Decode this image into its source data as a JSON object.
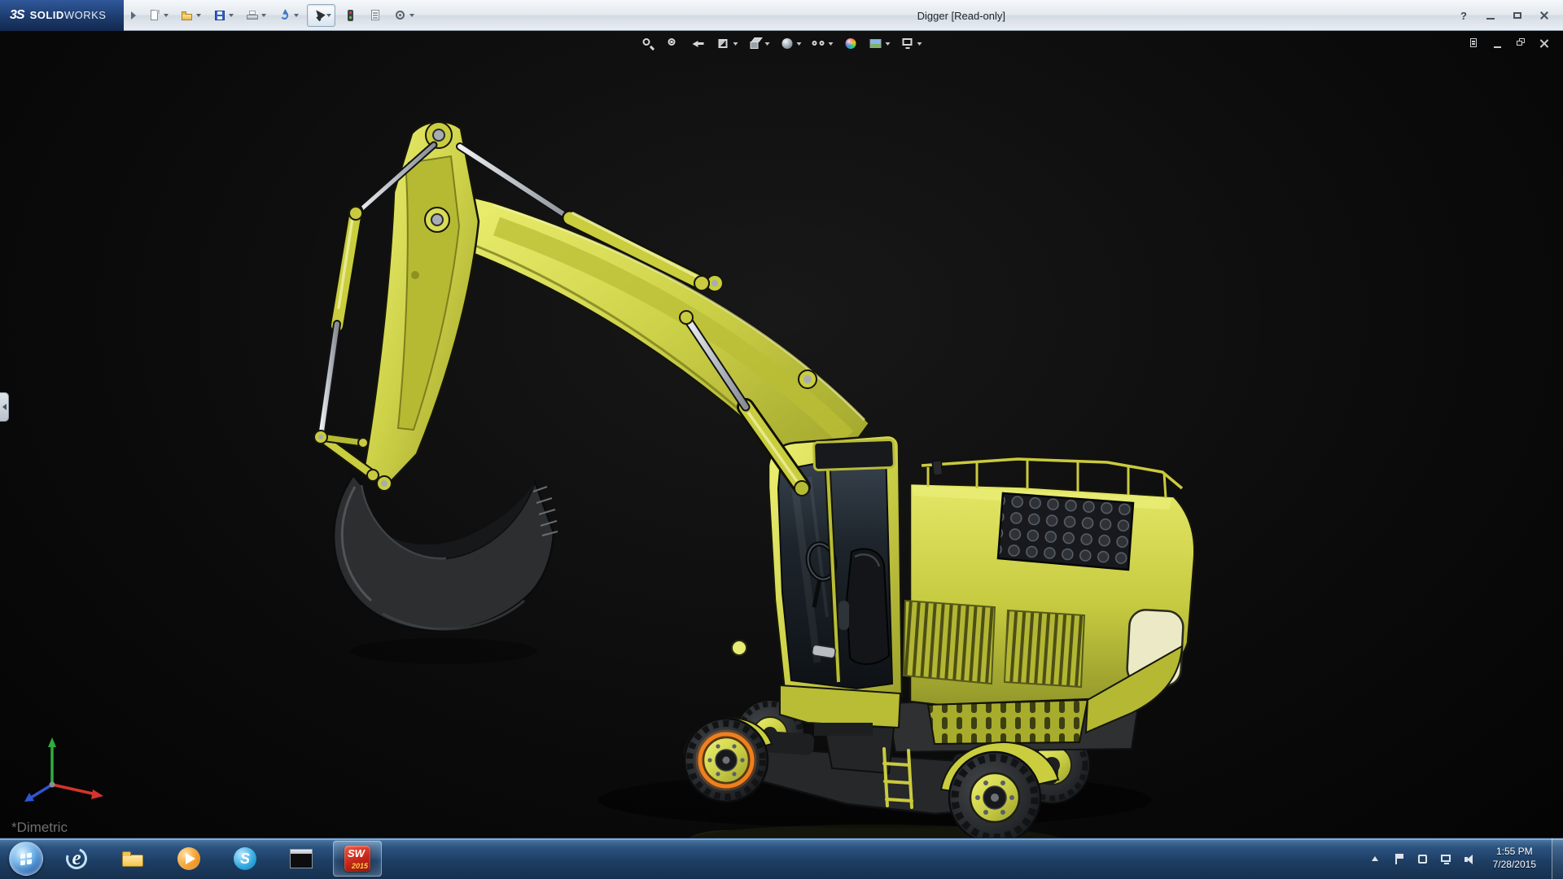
{
  "window": {
    "brand": {
      "mark": "3S",
      "name_bold": "SOLID",
      "name_light": "WORKS"
    },
    "title": "Digger [Read-only]",
    "controls": [
      {
        "name": "help-button",
        "icon": "win-help",
        "glyph": "?"
      },
      {
        "name": "minimize-button",
        "icon": "win-min"
      },
      {
        "name": "maximize-button",
        "icon": "win-max"
      },
      {
        "name": "close-button",
        "icon": "win-close"
      }
    ]
  },
  "main_toolbar": {
    "items": [
      {
        "name": "new-document-button",
        "icon": "new",
        "dropdown": true
      },
      {
        "name": "open-button",
        "icon": "open",
        "dropdown": true
      },
      {
        "name": "save-button",
        "icon": "save",
        "dropdown": true
      },
      {
        "name": "print-button",
        "icon": "print",
        "dropdown": true
      },
      {
        "name": "undo-button",
        "icon": "undo",
        "dropdown": true
      },
      {
        "name": "select-button",
        "icon": "select",
        "dropdown": true,
        "pressed": true
      },
      {
        "name": "rebuild-button",
        "icon": "rebuild"
      },
      {
        "name": "file-properties-button",
        "icon": "file-properties"
      },
      {
        "name": "options-button",
        "icon": "options",
        "dropdown": true
      }
    ]
  },
  "viewport": {
    "heads_up_toolbar": [
      {
        "name": "zoom-to-fit-button",
        "icon": "zoom-fit"
      },
      {
        "name": "zoom-to-area-button",
        "icon": "zoom-area"
      },
      {
        "name": "previous-view-button",
        "icon": "prev-view"
      },
      {
        "name": "section-view-button",
        "icon": "section",
        "dropdown": true
      },
      {
        "name": "view-orientation-button",
        "icon": "orientation",
        "dropdown": true
      },
      {
        "name": "display-style-button",
        "icon": "display-style",
        "dropdown": true
      },
      {
        "name": "hide-show-items-button",
        "icon": "hide-show",
        "dropdown": true
      },
      {
        "name": "edit-appearance-button",
        "icon": "appearance"
      },
      {
        "name": "apply-scene-button",
        "icon": "scene",
        "dropdown": true
      },
      {
        "name": "view-settings-button",
        "icon": "view-settings",
        "dropdown": true
      }
    ],
    "doc_controls": [
      {
        "name": "document-icon",
        "icon": "doc-part"
      },
      {
        "name": "doc-minimize-button",
        "icon": "doc-min"
      },
      {
        "name": "doc-restore-button",
        "icon": "doc-restore"
      },
      {
        "name": "doc-close-button",
        "icon": "doc-close"
      }
    ],
    "view_label": "*Dimetric",
    "model": {
      "name": "Digger",
      "body_color": "#c9cd3e",
      "selection_highlight_color": "#f07f1c"
    }
  },
  "taskbar": {
    "items": [
      {
        "name": "internet-explorer-button",
        "icon": "ie",
        "glyph": "e"
      },
      {
        "name": "windows-explorer-button",
        "icon": "explorer"
      },
      {
        "name": "media-player-button",
        "icon": "wmp"
      },
      {
        "name": "skype-button",
        "icon": "skype",
        "glyph": "S"
      },
      {
        "name": "command-prompt-button",
        "icon": "cmd"
      },
      {
        "name": "solidworks-2015-button",
        "icon": "sw2015",
        "glyph": "SW",
        "badge": "2015",
        "running": true
      }
    ],
    "tray": {
      "icons": [
        {
          "name": "show-hidden-icons-button",
          "icon": "tray-chevron"
        },
        {
          "name": "action-center-flag-button",
          "icon": "tray-flag"
        },
        {
          "name": "tray-app-button",
          "icon": "tray-app"
        },
        {
          "name": "network-button",
          "icon": "tray-network"
        },
        {
          "name": "volume-button",
          "icon": "tray-volume"
        }
      ],
      "clock_time": "1:55 PM",
      "clock_date": "7/28/2015"
    }
  }
}
